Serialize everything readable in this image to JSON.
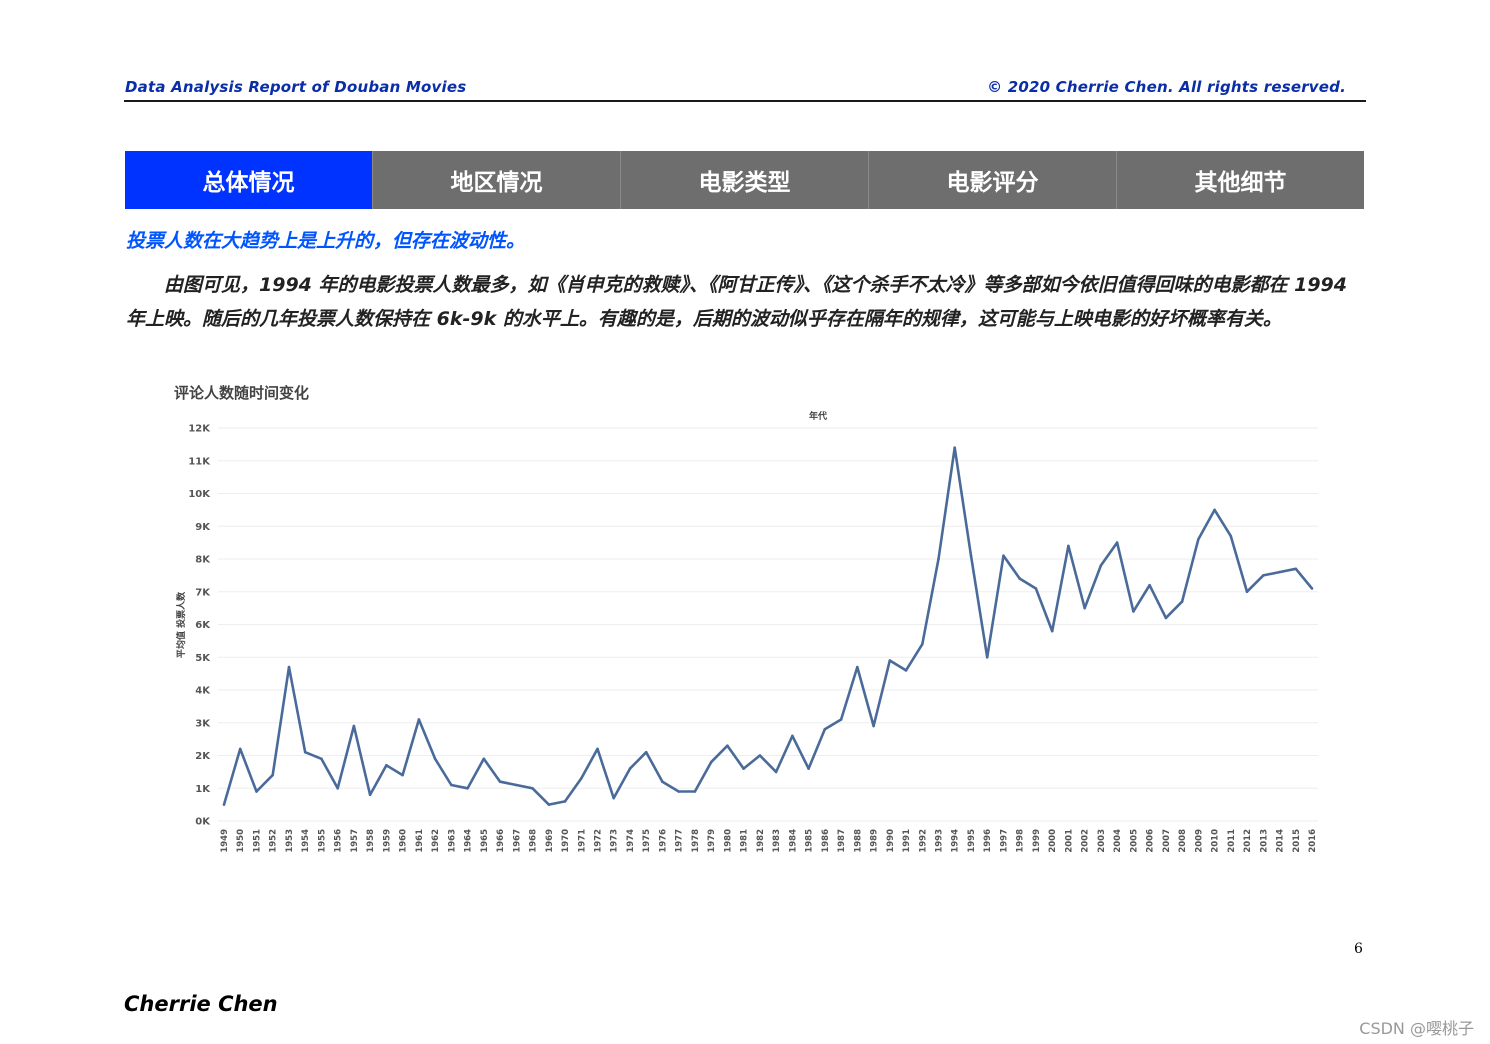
{
  "header": {
    "left": "Data Analysis Report of Douban Movies",
    "right": "© 2020 Cherrie Chen. All rights reserved."
  },
  "tabs": [
    {
      "label": "总体情况",
      "active": true
    },
    {
      "label": "地区情况",
      "active": false
    },
    {
      "label": "电影类型",
      "active": false
    },
    {
      "label": "电影评分",
      "active": false
    },
    {
      "label": "其他细节",
      "active": false
    }
  ],
  "subhead": "投票人数在大趋势上是上升的，但存在波动性。",
  "paragraph": "由图可见，1994 年的电影投票人数最多，如《肖申克的救赎》、《阿甘正传》、《这个杀手不太冷》等多部如今依旧值得回味的电影都在 1994 年上映。随后的几年投票人数保持在 6k-9k 的水平上。有趣的是，后期的波动似乎存在隔年的规律，这可能与上映电影的好坏概率有关。",
  "chart_data": {
    "type": "line",
    "title": "评论人数随时间变化",
    "xlabel": "年代",
    "ylabel": "平均值 投票人数",
    "ylim": [
      0,
      12000
    ],
    "yticks": [
      "0K",
      "1K",
      "2K",
      "3K",
      "4K",
      "5K",
      "6K",
      "7K",
      "8K",
      "9K",
      "10K",
      "11K",
      "12K"
    ],
    "color": "#4a6b9a",
    "x": [
      "1949",
      "1950",
      "1951",
      "1952",
      "1953",
      "1954",
      "1955",
      "1956",
      "1957",
      "1958",
      "1959",
      "1960",
      "1961",
      "1962",
      "1963",
      "1964",
      "1965",
      "1966",
      "1967",
      "1968",
      "1969",
      "1970",
      "1971",
      "1972",
      "1973",
      "1974",
      "1975",
      "1976",
      "1977",
      "1978",
      "1979",
      "1980",
      "1981",
      "1982",
      "1983",
      "1984",
      "1985",
      "1986",
      "1987",
      "1988",
      "1989",
      "1990",
      "1991",
      "1992",
      "1993",
      "1994",
      "1995",
      "1996",
      "1997",
      "1998",
      "1999",
      "2000",
      "2001",
      "2002",
      "2003",
      "2004",
      "2005",
      "2006",
      "2007",
      "2008",
      "2009",
      "2010",
      "2011",
      "2012",
      "2013",
      "2014",
      "2015",
      "2016"
    ],
    "series": [
      {
        "values": [
          500,
          2200,
          900,
          1400,
          4700,
          2100,
          1900,
          1000,
          2900,
          800,
          1700,
          1400,
          3100,
          1900,
          1100,
          1000,
          1900,
          1200,
          1100,
          1000,
          500,
          600,
          1300,
          2200,
          700,
          1600,
          2100,
          1200,
          900,
          900,
          1800,
          2300,
          1600,
          2000,
          1500,
          2600,
          1600,
          2800,
          3100,
          4700,
          2900,
          4900,
          4600,
          5400,
          8000,
          11400,
          8100,
          5000,
          8100,
          7400,
          7100,
          5800,
          8400,
          6500,
          7800,
          8500,
          6400,
          7200,
          6200,
          6700,
          8600,
          9500,
          8700,
          7000,
          7500,
          7600,
          7700,
          7100
        ]
      }
    ]
  },
  "page_number": "6",
  "author": "Cherrie Chen",
  "watermark": "CSDN @嘤桃子"
}
